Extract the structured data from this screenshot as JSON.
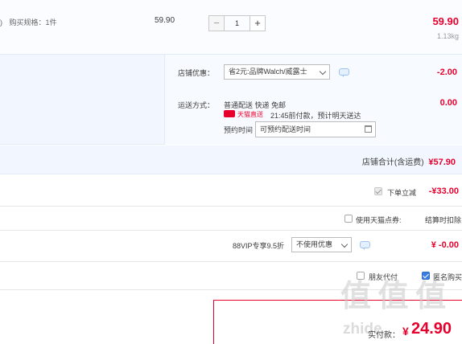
{
  "item": {
    "spec_label": "购买规格：",
    "spec_value": "1件",
    "spec_prefix": ")",
    "unit_price": "59.90",
    "quantity": "1",
    "minus": "−",
    "plus": "+",
    "subtotal": "59.90",
    "weight": "1.13kg"
  },
  "shop": {
    "promo_label": "店铺优惠：",
    "promo_selected": "省2元:品牌Walch/威露士",
    "promo_discount": "-2.00",
    "shipping_label": "运送方式：",
    "shipping_method": "普通配送 快递 免邮",
    "shipping_fee": "0.00",
    "tmall_express": "天猫直送",
    "delivery_note": "21:45前付款，预计明天送达",
    "schedule_label": "预约时间",
    "schedule_value": "可预约配送时间",
    "total_label": "店铺合计(含运费)",
    "total_value": "¥57.90"
  },
  "discounts": {
    "order_reduce_label": "下单立减",
    "order_reduce_value": "-¥33.00",
    "points_label": "使用天猫点券:",
    "settle_label": "结算时扣除",
    "vip_label": "88VIP专享9.5折",
    "vip_selected": "不使用优惠",
    "vip_value": "¥ -0.00"
  },
  "options": {
    "friend_pay": "朋友代付",
    "anonymous": "匿名购买"
  },
  "payment": {
    "label": "实付款：",
    "currency": "¥",
    "amount": "24.90"
  },
  "watermark": {
    "logo": "值 值 值",
    "site": "zhide"
  },
  "colors": {
    "price_red": "#e8002d",
    "light_blue_bg": "#f2f7ff",
    "checkbox_blue": "#3a7de0"
  }
}
